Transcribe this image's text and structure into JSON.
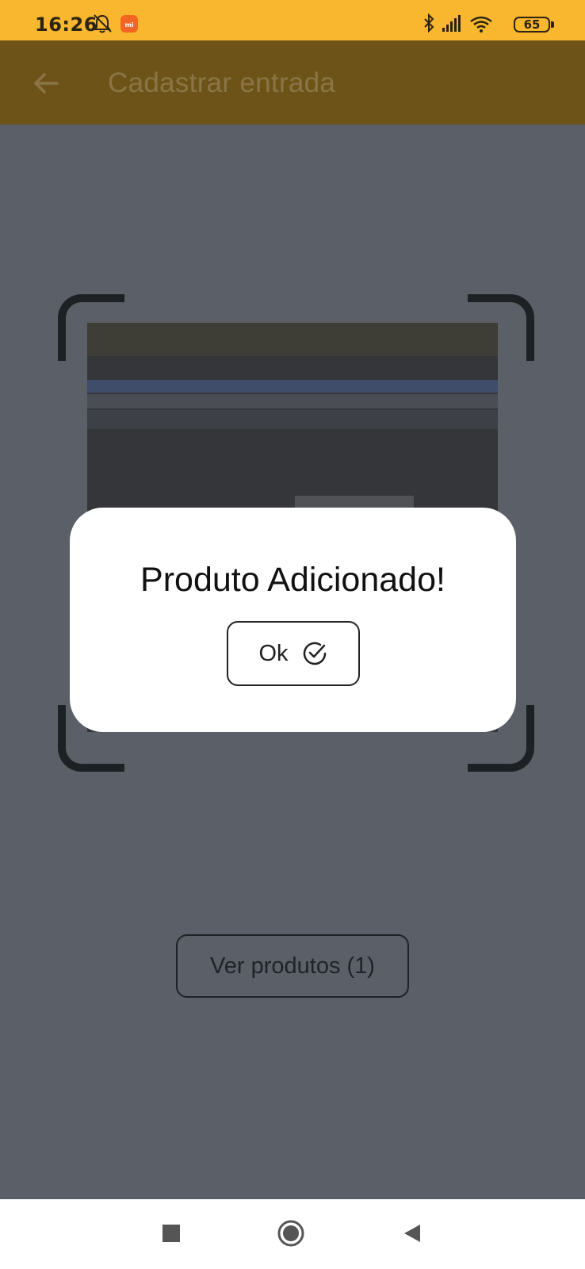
{
  "status_bar": {
    "time": "16:26",
    "battery": "65",
    "icons": [
      "dnd-off-icon",
      "mi-app-icon",
      "bluetooth-icon",
      "signal-icon",
      "wifi-icon",
      "battery-icon"
    ]
  },
  "app_bar": {
    "title": "Cadastrar entrada",
    "back_icon": "arrow-left-icon"
  },
  "scanner": {
    "frame": "qr-scanner-frame"
  },
  "main": {
    "view_products_label": "Ver produtos (1)"
  },
  "dialog": {
    "title": "Produto Adicionado!",
    "ok_label": "Ok",
    "ok_icon": "check-circle-icon"
  },
  "nav_bar": {
    "icons": [
      "recent-apps-icon",
      "home-icon",
      "back-icon"
    ]
  },
  "colors": {
    "status_bar": "#f9b62f",
    "app_bar_dimmed": "#6e5318",
    "scrim": "#5b5f68",
    "dialog_bg": "#ffffff"
  }
}
